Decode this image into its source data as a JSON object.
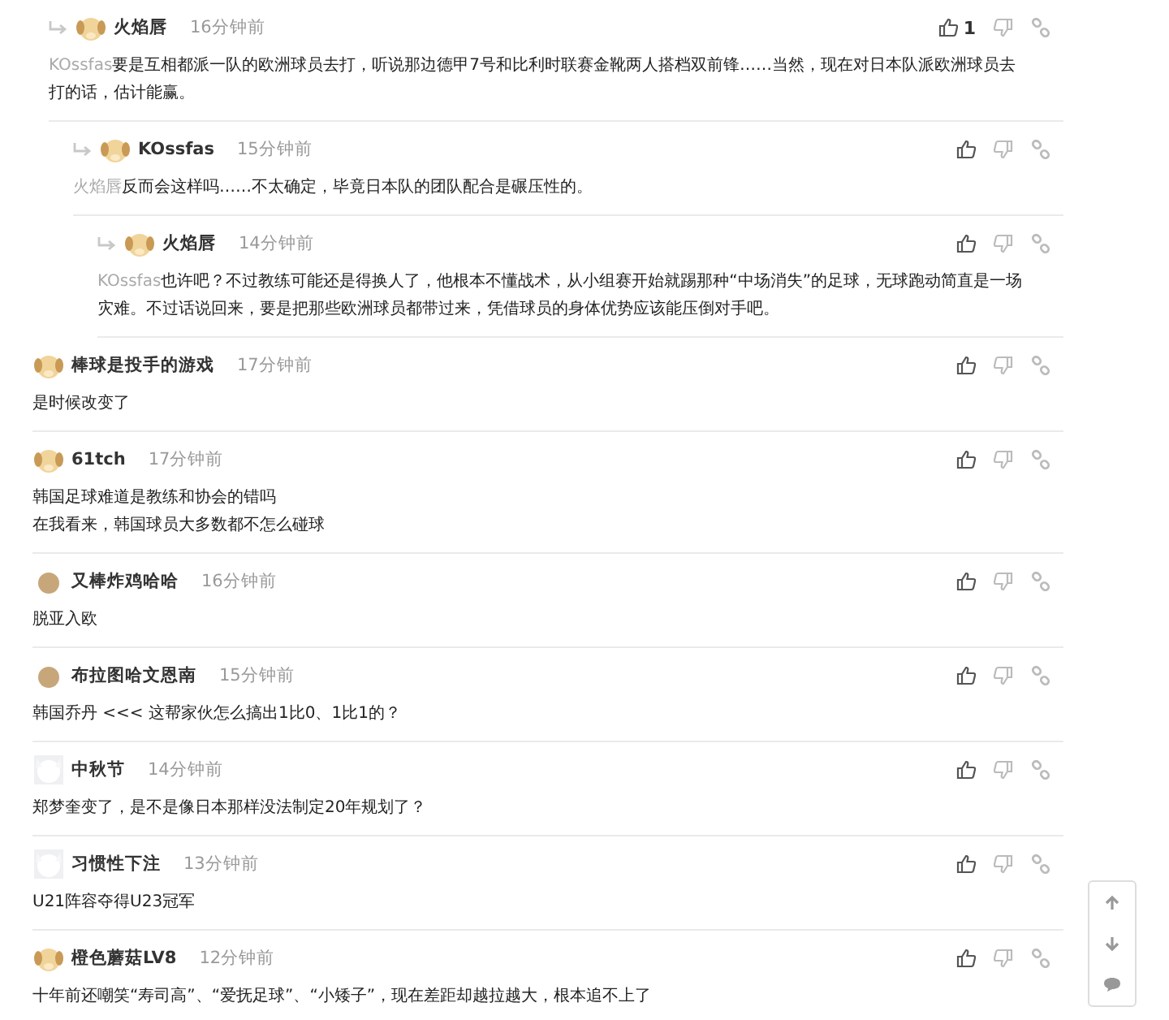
{
  "comments": [
    {
      "reply": true,
      "kind": "dog",
      "author": "火焰唇",
      "time": "16分钟前",
      "likes": "1",
      "mention": "KOssfas",
      "lines": [
        "要是互相都派一队的欧洲球员去打，听说那边德甲7号和比利时联赛金靴两人搭档双前锋……当然，现在对日本队派欧洲球员去打的话，估计能赢。"
      ],
      "children": [
        {
          "reply": true,
          "kind": "dog",
          "author": "KOssfas",
          "time": "15分钟前",
          "mention": "火焰唇",
          "lines": [
            "反而会这样吗……不太确定，毕竟日本队的团队配合是碾压性的。"
          ],
          "children": [
            {
              "reply": true,
              "kind": "dog",
              "author": "火焰唇",
              "time": "14分钟前",
              "mention": "KOssfas",
              "lines": [
                "也许吧？不过教练可能还是得换人了，他根本不懂战术，从小组赛开始就踢那种“中场消失”的足球，无球跑动简直是一场灾难。不过话说回来，要是把那些欧洲球员都带过来，凭借球员的身体优势应该能压倒对手吧。"
              ]
            }
          ]
        }
      ]
    },
    {
      "reply": false,
      "kind": "dog",
      "author": "棒球是投手的游戏",
      "time": "17分钟前",
      "lines": [
        "是时候改变了"
      ]
    },
    {
      "reply": false,
      "kind": "dog",
      "author": "61tch",
      "time": "17分钟前",
      "lines": [
        "韩国足球难道是教练和协会的错吗",
        "在我看来，韩国球员大多数都不怎么碰球"
      ]
    },
    {
      "reply": false,
      "kind": "ball",
      "author": "又棒炸鸡哈哈",
      "time": "16分钟前",
      "lines": [
        "脱亚入欧"
      ]
    },
    {
      "reply": false,
      "kind": "ball",
      "author": "布拉图哈文恩南",
      "time": "15分钟前",
      "lines": [
        "韩国乔丹 <<< 这帮家伙怎么搞出1比0、1比1的？"
      ]
    },
    {
      "reply": false,
      "kind": "white",
      "author": "中秋节",
      "time": "14分钟前",
      "lines": [
        "郑梦奎变了，是不是像日本那样没法制定20年规划了？"
      ]
    },
    {
      "reply": false,
      "kind": "white",
      "author": "习惯性下注",
      "time": "13分钟前",
      "lines": [
        "U21阵容夺得U23冠军"
      ]
    },
    {
      "reply": false,
      "kind": "dog",
      "author": "橙色蘑菇LV8",
      "time": "12分钟前",
      "lines": [
        "十年前还嘲笑“寿司高”、“爱抚足球”、“小矮子”，现在差距却越拉越大，根本追不上了"
      ]
    }
  ]
}
